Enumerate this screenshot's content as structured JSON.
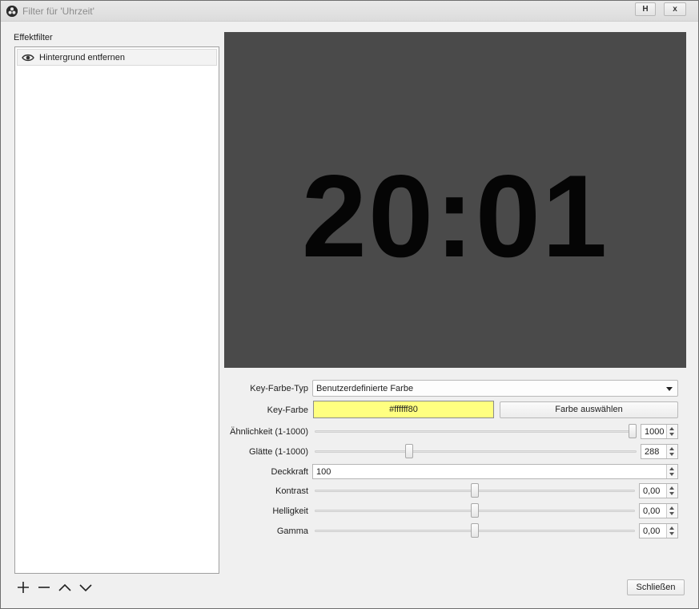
{
  "window": {
    "title": "Filter für 'Uhrzeit'",
    "help_button": "H",
    "close_button": "x"
  },
  "effect_filters": {
    "heading": "Effektfilter",
    "items": [
      {
        "label": "Hintergrund entfernen",
        "visible": true
      }
    ],
    "toolbar": [
      "add-icon",
      "remove-icon",
      "move-up-icon",
      "move-down-icon"
    ]
  },
  "preview": {
    "clock_text": "20:01",
    "background_color": "#4a4a4a"
  },
  "properties": {
    "key_color_type": {
      "label": "Key-Farbe-Typ",
      "value": "Benutzerdefinierte Farbe"
    },
    "key_color": {
      "label": "Key-Farbe",
      "value": "#ffffff80",
      "swatch_color": "#ffff80",
      "button": "Farbe auswählen"
    },
    "similarity": {
      "label": "Ähnlichkeit (1-1000)",
      "value": "1000",
      "min": 1,
      "max": 1000,
      "level": 1000
    },
    "smoothness": {
      "label": "Glätte (1-1000)",
      "value": "288",
      "min": 1,
      "max": 1000,
      "level": 288
    },
    "opacity": {
      "label": "Deckkraft",
      "value": "100"
    },
    "contrast": {
      "label": "Kontrast",
      "value": "0,00",
      "level": 0.0
    },
    "brightness": {
      "label": "Helligkeit",
      "value": "0,00",
      "level": 0.0
    },
    "gamma": {
      "label": "Gamma",
      "value": "0,00",
      "level": 0.0
    }
  },
  "footer": {
    "close_label": "Schließen"
  }
}
